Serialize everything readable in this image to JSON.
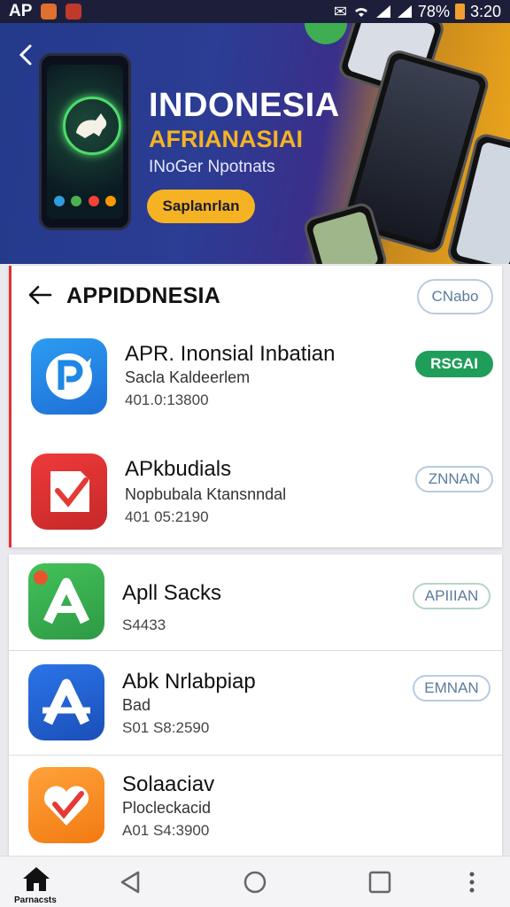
{
  "status_bar": {
    "app_label": "AP",
    "battery_text": "78%",
    "time": "3:20"
  },
  "banner": {
    "title": "INDONESIA",
    "subtitle": "AFRIANASIAI",
    "tagline": "INoGer Npotnats",
    "cta_label": "Saplanrlan"
  },
  "list": {
    "header_title": "APPIDDNESIA",
    "header_button": "CNabo",
    "apps": [
      {
        "name": "APR. Inonsial Inbatian",
        "subtitle": "Sacla Kaldeerlem",
        "meta": "401.0:13800",
        "action": "RSGAI",
        "icon_name": "p-badge-icon",
        "icon_color": "#1e88e5"
      },
      {
        "name": "APkbudials",
        "subtitle": "Nopbubala Ktansnndal",
        "meta": "401 05:2190",
        "action": "ZNNAN",
        "icon_name": "checkmark-doc-icon",
        "icon_color": "#e53935"
      },
      {
        "name": "Apll Sacks",
        "subtitle": "",
        "meta": "S4433",
        "action": "APIIIAN",
        "icon_name": "a-letter-icon",
        "icon_color": "#34a853"
      },
      {
        "name": "Abk Nrlabpiap",
        "subtitle": "Bad",
        "meta": "S01 S8:2590",
        "action": "EMNAN",
        "icon_name": "a-arrow-icon",
        "icon_color": "#1e5fd6"
      },
      {
        "name": "Solaaciav",
        "subtitle": "Plocleckacid",
        "meta": "A01 S4:3900",
        "action": "",
        "icon_name": "heart-check-icon",
        "icon_color": "#ff8a1e"
      }
    ]
  },
  "navbar": {
    "home_label": "Parnacsts"
  },
  "colors": {
    "accent_green": "#1f9e5a",
    "banner_gold": "#f5b323",
    "banner_blue": "#243a8a"
  }
}
